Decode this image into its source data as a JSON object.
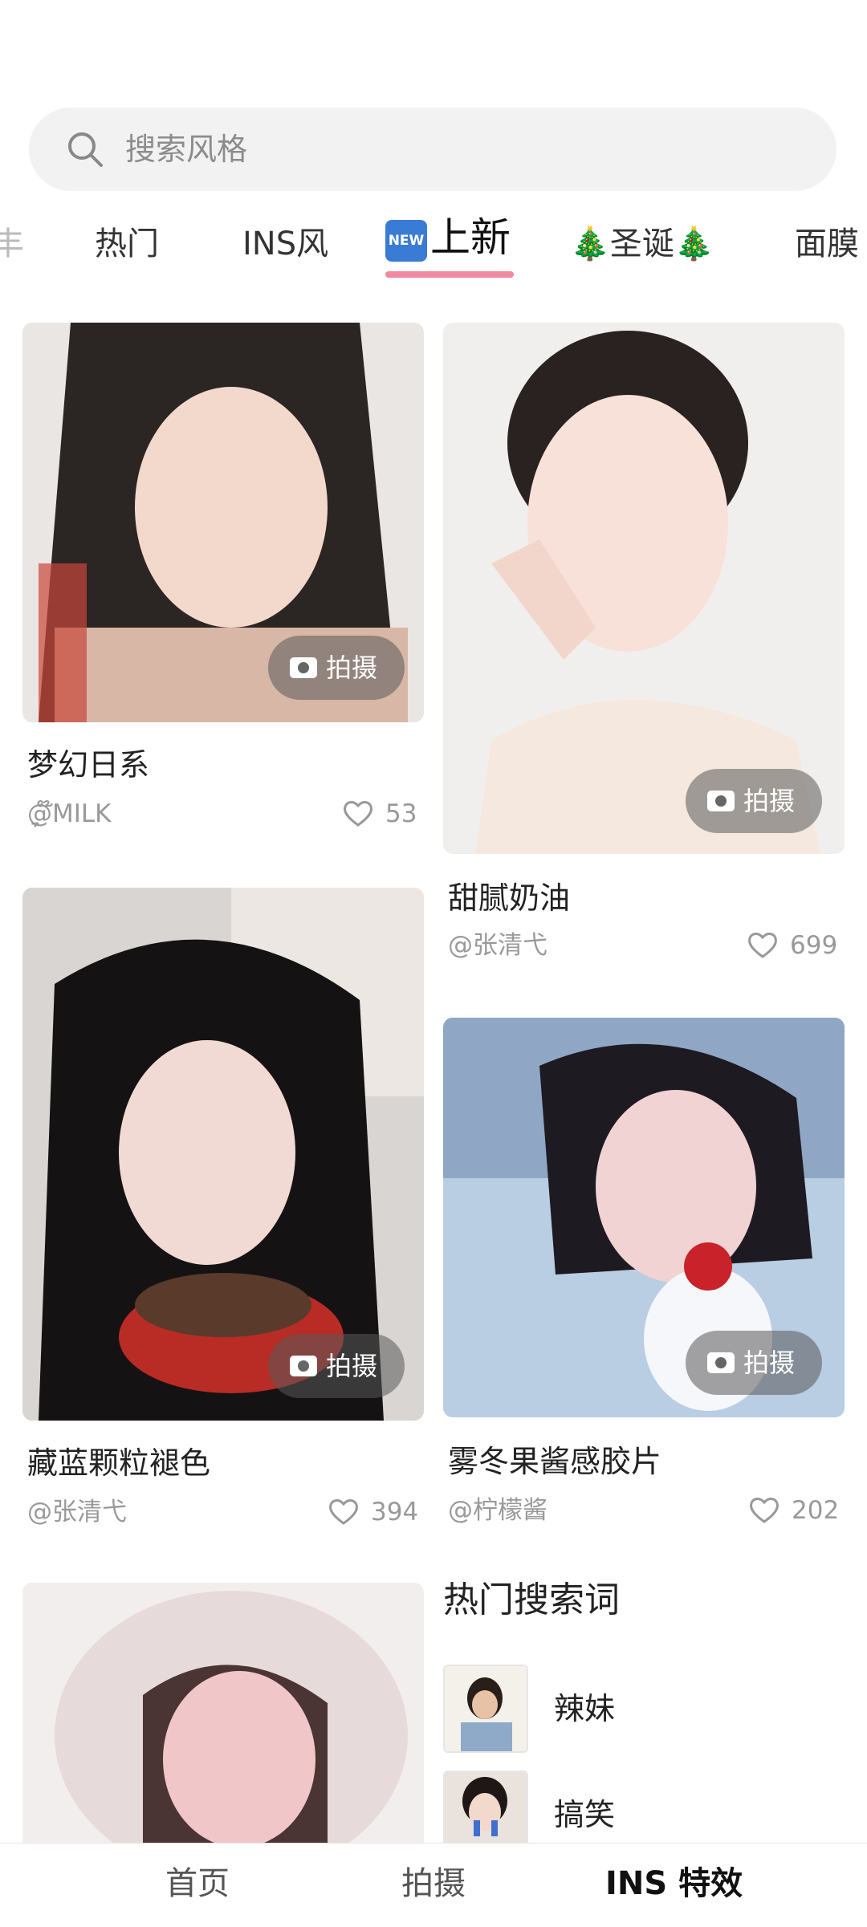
{
  "search": {
    "placeholder": "搜索风格",
    "icon": "search-icon"
  },
  "tabs": [
    {
      "label": "热门"
    },
    {
      "label": "INS风"
    },
    {
      "label": "上新",
      "badge": "NEW",
      "active": true
    },
    {
      "label": "🎄圣诞🎄"
    },
    {
      "label": "面膜"
    }
  ],
  "cards": [
    {
      "title": "梦幻日系",
      "author": "@ִֶָ໊MILK",
      "likes": "53",
      "shoot_label": "拍摄"
    },
    {
      "title": "甜腻奶油",
      "author": "@张清弋",
      "likes": "699",
      "shoot_label": "拍摄"
    },
    {
      "title": "藏蓝颗粒褪色",
      "author": "@张清弋",
      "likes": "394",
      "shoot_label": "拍摄"
    },
    {
      "title": "雾冬果酱感胶片",
      "author": "@柠檬酱",
      "likes": "202",
      "shoot_label": "拍摄"
    }
  ],
  "hot_search": {
    "title": "热门搜索词",
    "items": [
      {
        "label": "辣妹"
      },
      {
        "label": "搞笑"
      }
    ]
  },
  "bottom_nav": [
    {
      "label": "首页"
    },
    {
      "label": "拍摄"
    },
    {
      "label": "INS 特效",
      "active": true
    }
  ],
  "colors": {
    "accent_underline": "#f08aa0",
    "new_badge": "#3a7bd5"
  }
}
